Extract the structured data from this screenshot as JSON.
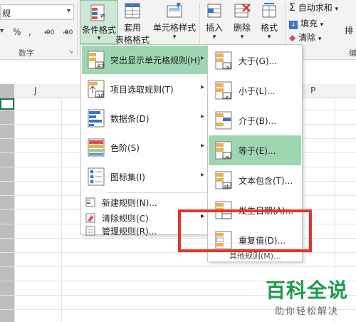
{
  "ribbon": {
    "number_format_value": "规",
    "number_format_arrow": "▾",
    "num_symbols": {
      "currency": "▾",
      "percent": "%",
      "comma": ",",
      "inc_decimal": ".00",
      "dec_decimal": ".00",
      "inc_arrow": "←",
      "dec_arrow": "→"
    },
    "number_group_label": "数字",
    "conditional_format": {
      "label": "条件格式",
      "arrow": "▾"
    },
    "table_format": {
      "line1": "套用",
      "line2": "表格格式",
      "arrow": "▾"
    },
    "cell_style": {
      "label": "单元格样式",
      "arrow": "▾"
    },
    "insert": {
      "label": "插入",
      "arrow": "▾"
    },
    "delete": {
      "label": "删除",
      "arrow": "▾"
    },
    "format": {
      "label": "格式",
      "arrow": "▾"
    },
    "autosum": {
      "label": "自动求和",
      "arrow": "▾",
      "symbol": "Σ"
    },
    "fill": {
      "label": "填充",
      "arrow": "▾"
    },
    "clear": {
      "label": "清除",
      "arrow": "▾"
    },
    "sort_partial": "排",
    "edit_group_partial": "编"
  },
  "grid": {
    "col_j": "J",
    "col_p": "P"
  },
  "menu": {
    "items": [
      {
        "label": "突出显示单元格规则(H)",
        "arrow": "▸",
        "icon": "highlight-rules-icon"
      },
      {
        "label": "项目选取规则(T)",
        "arrow": "▸",
        "icon": "top-bottom-rules-icon",
        "badge": "10"
      },
      {
        "label": "数据条(D)",
        "arrow": "▸",
        "icon": "data-bars-icon"
      },
      {
        "label": "色阶(S)",
        "arrow": "▸",
        "icon": "color-scales-icon"
      },
      {
        "label": "图标集(I)",
        "arrow": "▸",
        "icon": "icon-sets-icon"
      }
    ],
    "simple_items": [
      {
        "label": "新建规则(N)...",
        "icon": "new-rule-icon"
      },
      {
        "label": "清除规则(C)",
        "arrow": "▸",
        "icon": "clear-rules-icon"
      },
      {
        "label": "管理规则(R)...",
        "icon": "manage-rules-icon"
      }
    ]
  },
  "submenu": {
    "items": [
      {
        "label": "大于(G)...",
        "icon": "greater-than-icon",
        "glyph": ">"
      },
      {
        "label": "小于(L)...",
        "icon": "less-than-icon",
        "glyph": "<"
      },
      {
        "label": "介于(B)...",
        "icon": "between-icon"
      },
      {
        "label": "等于(E)...",
        "icon": "equal-to-icon",
        "glyph": "="
      },
      {
        "label": "文本包含(T)...",
        "icon": "text-contains-icon",
        "glyph": "ab"
      },
      {
        "label": "发生日期(A)...",
        "icon": "date-occurring-icon"
      },
      {
        "label": "重复值(D)...",
        "icon": "duplicate-values-icon"
      }
    ],
    "more": "其他规则(M)..."
  },
  "watermark": {
    "title": "百科全说",
    "subtitle": "助你轻松解决"
  },
  "colors": {
    "highlight": "#9fd6b2",
    "red_box": "#e8322c",
    "brand_green": "#1d9a4a"
  }
}
